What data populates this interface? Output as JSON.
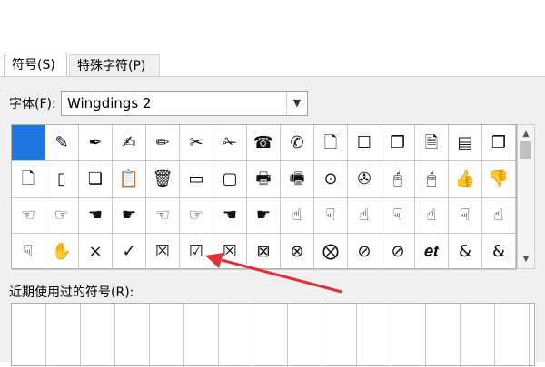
{
  "tabs": [
    {
      "label": "符号(S)",
      "active": true
    },
    {
      "label": "特殊字符(P)",
      "active": false
    }
  ],
  "font": {
    "label": "字体(F):",
    "value": "Wingdings 2"
  },
  "symbol_grid": {
    "rows": [
      [
        {
          "glyph": "",
          "name": "selected-blank-symbol"
        },
        {
          "glyph": "✎",
          "name": "pencil-symbol"
        },
        {
          "glyph": "✒",
          "name": "pen-symbol"
        },
        {
          "glyph": "✍",
          "name": "brush-symbol"
        },
        {
          "glyph": "✏",
          "name": "marker-symbol"
        },
        {
          "glyph": "✂",
          "name": "open-scissors-symbol"
        },
        {
          "glyph": "✁",
          "name": "scissors-symbol"
        },
        {
          "glyph": "☎",
          "name": "telephone-symbol"
        },
        {
          "glyph": "✆",
          "name": "handset-symbol"
        },
        {
          "glyph": "🗋",
          "name": "document-symbol"
        },
        {
          "glyph": "☐",
          "name": "page-symbol"
        },
        {
          "glyph": "❐",
          "name": "pages-symbol"
        },
        {
          "glyph": "🗎",
          "name": "text-document-symbol"
        },
        {
          "glyph": "▤",
          "name": "lined-document-symbol"
        },
        {
          "glyph": "❒",
          "name": "stacked-pages-symbol"
        }
      ],
      [
        {
          "glyph": "🗋",
          "name": "blank-page-symbol"
        },
        {
          "glyph": "▯",
          "name": "portrait-page-symbol"
        },
        {
          "glyph": "❏",
          "name": "copy-pages-symbol"
        },
        {
          "glyph": "📋",
          "name": "clipboard-symbol"
        },
        {
          "glyph": "🗑",
          "name": "trash-can-symbol"
        },
        {
          "glyph": "▭",
          "name": "window-symbol"
        },
        {
          "glyph": "▢",
          "name": "rounded-window-symbol"
        },
        {
          "glyph": "🖶",
          "name": "printer-symbol"
        },
        {
          "glyph": "🖷",
          "name": "fax-symbol"
        },
        {
          "glyph": "⊙",
          "name": "disc-symbol"
        },
        {
          "glyph": "✇",
          "name": "tape-symbol"
        },
        {
          "glyph": "🖰",
          "name": "mouse-symbol"
        },
        {
          "glyph": "🖱",
          "name": "mouse-alt-symbol"
        },
        {
          "glyph": "👍",
          "name": "thumbs-up-symbol"
        },
        {
          "glyph": "👎",
          "name": "thumbs-down-symbol"
        }
      ],
      [
        {
          "glyph": "☜",
          "name": "hand-left-outline-symbol"
        },
        {
          "glyph": "☞",
          "name": "hand-right-outline-symbol"
        },
        {
          "glyph": "☚",
          "name": "hand-left-solid-symbol"
        },
        {
          "glyph": "☛",
          "name": "hand-right-solid-symbol"
        },
        {
          "glyph": "☜",
          "name": "hand-left-outline-2-symbol"
        },
        {
          "glyph": "☞",
          "name": "hand-right-outline-2-symbol"
        },
        {
          "glyph": "☚",
          "name": "hand-left-solid-2-symbol"
        },
        {
          "glyph": "☛",
          "name": "hand-right-solid-2-symbol"
        },
        {
          "glyph": "☝",
          "name": "hand-up-outline-symbol"
        },
        {
          "glyph": "☟",
          "name": "hand-down-outline-symbol"
        },
        {
          "glyph": "☝",
          "name": "hand-up-solid-symbol"
        },
        {
          "glyph": "☟",
          "name": "hand-down-solid-symbol"
        },
        {
          "glyph": "☝",
          "name": "hand-up-outline-2-symbol"
        },
        {
          "glyph": "☟",
          "name": "hand-down-outline-2-symbol"
        },
        {
          "glyph": "☝",
          "name": "hand-up-solid-2-symbol"
        }
      ],
      [
        {
          "glyph": "☟",
          "name": "hand-down-solid-2-symbol"
        },
        {
          "glyph": "✋",
          "name": "open-hand-symbol"
        },
        {
          "glyph": "×",
          "name": "multiply-symbol"
        },
        {
          "glyph": "✓",
          "name": "check-mark-symbol"
        },
        {
          "glyph": "☒",
          "name": "boxed-x-symbol"
        },
        {
          "glyph": "☑",
          "name": "boxed-check-symbol"
        },
        {
          "glyph": "☒",
          "name": "boxed-x-thin-symbol"
        },
        {
          "glyph": "⊠",
          "name": "boxed-x-bold-symbol"
        },
        {
          "glyph": "⊗",
          "name": "circled-x-symbol"
        },
        {
          "glyph": "⨂",
          "name": "circled-x-bold-symbol"
        },
        {
          "glyph": "⊘",
          "name": "prohibited-symbol"
        },
        {
          "glyph": "⊘",
          "name": "prohibited-bold-symbol"
        },
        {
          "glyph": "𝒆𝒕",
          "name": "et-ligature-symbol"
        },
        {
          "glyph": "&",
          "name": "ampersand-bold-symbol"
        },
        {
          "glyph": "&",
          "name": "ampersand-symbol"
        }
      ]
    ]
  },
  "recent_label": "近期使用过的符号(R):",
  "colors": {
    "selection": "#1e78e0",
    "annotation_arrow": "#e0303a"
  }
}
